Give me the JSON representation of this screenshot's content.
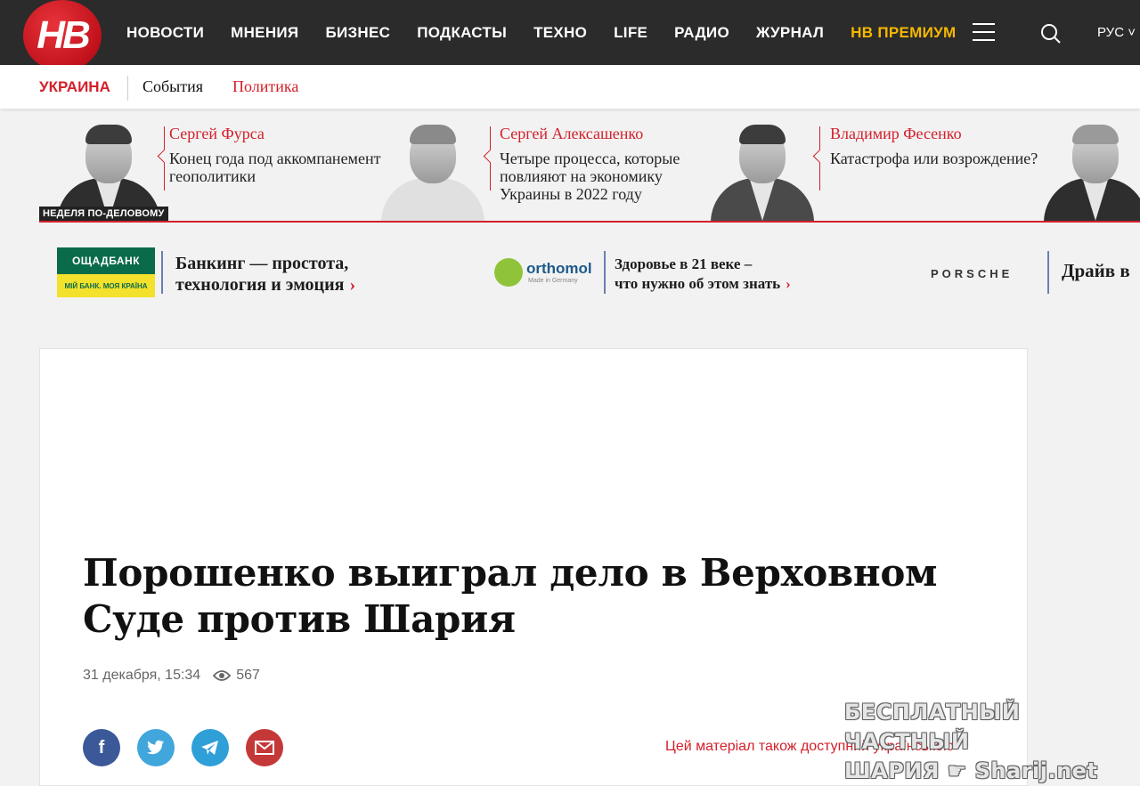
{
  "header": {
    "logo_text": "НВ",
    "nav": [
      "НОВОСТИ",
      "МНЕНИЯ",
      "БИЗНЕС",
      "ПОДКАСТЫ",
      "ТЕХНО",
      "LIFE",
      "РАДИО",
      "ЖУРНАЛ"
    ],
    "premium": "НВ ПРЕМИУМ",
    "lang": "РУС ˅"
  },
  "subnav": {
    "section": "УКРАИНА",
    "events": "События",
    "politics": "Политика"
  },
  "opinions": [
    {
      "author": "Сергей Фурса",
      "title": "Конец года под аккомпанемент геополитики",
      "tag": "НЕДЕЛЯ ПО-ДЕЛОВОМУ"
    },
    {
      "author": "Сергей Алексашенко",
      "title": "Четыре процесса, которые повлияют на экономику Украины в 2022 году"
    },
    {
      "author": "Владимир Фесенко",
      "title": "Катастрофа или возрождение?"
    }
  ],
  "partners": {
    "oschad_logo": "ОЩАДБАНК",
    "oschad_slogan": "МІЙ БАНК. МОЯ КРАЇНА",
    "oschad_text_1": "Банкинг — простота,",
    "oschad_text_2": "технология и эмоция",
    "ortho_logo": "orthomol",
    "ortho_sub": "Made in Germany",
    "ortho_text_1": "Здоровье в 21 веке –",
    "ortho_text_2": "что нужно об этом знать",
    "porsche_logo": "PORSCHE",
    "porsche_text": "Драйв в"
  },
  "article": {
    "title": "Порошенко выиграл дело в Верховном Суде против Шария",
    "date": "31 декабря, 15:34",
    "views": "567",
    "ua_link": "Цей матеріал також доступний українською"
  },
  "watermark": {
    "line1": "БЕСПЛАТНЫЙ ЧАСТНЫЙ",
    "line2": "ШАРИЯ",
    "line3": "Sharij.net"
  }
}
